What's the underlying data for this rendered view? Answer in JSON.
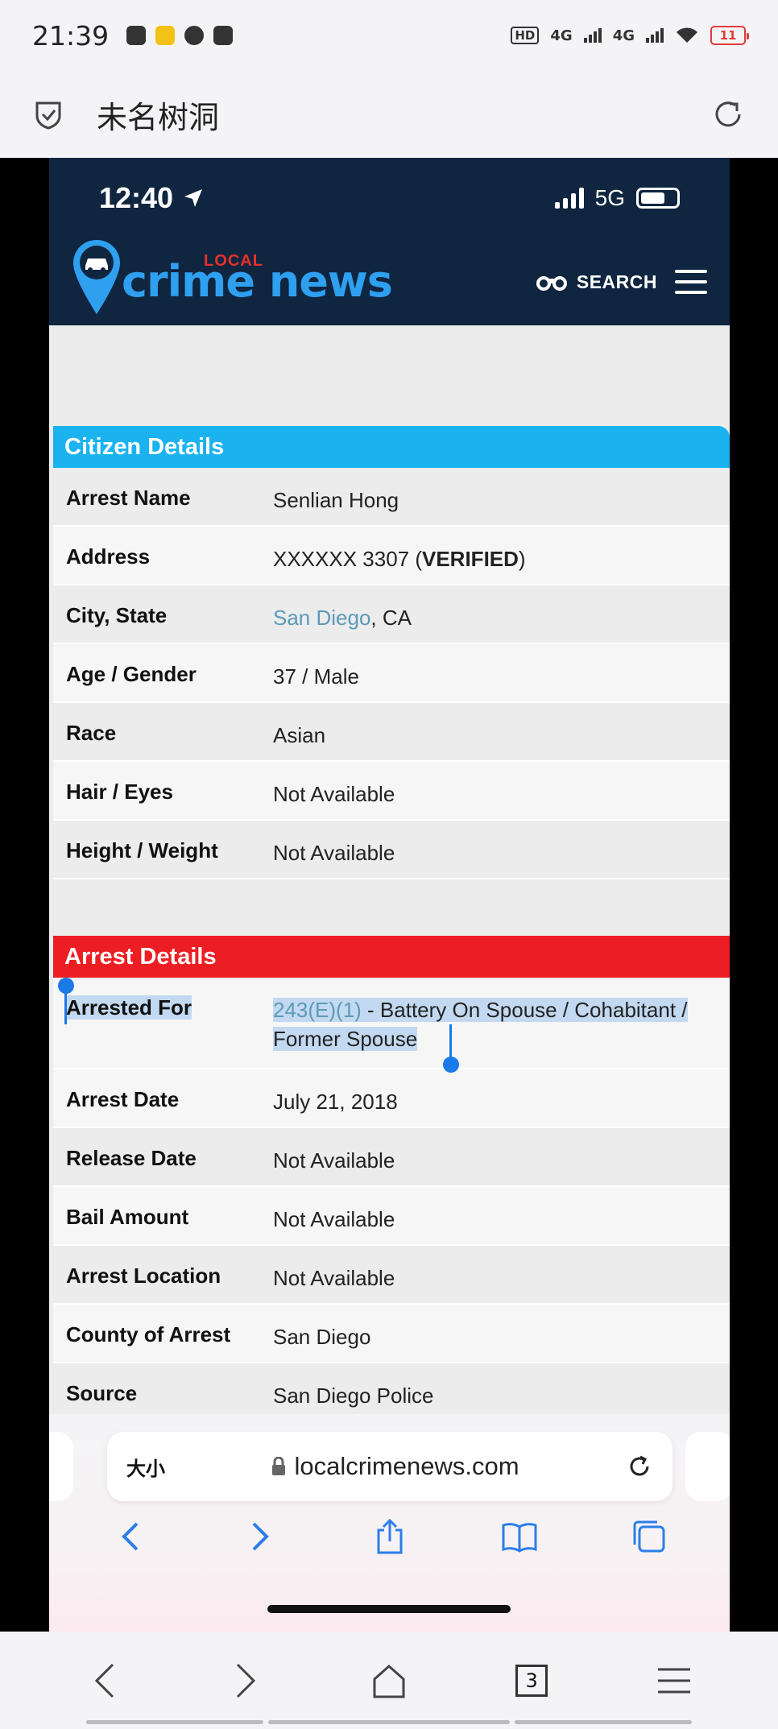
{
  "android_status": {
    "time": "21:39",
    "hd": "HD",
    "net1": "4G",
    "net2": "4G",
    "battery": "11"
  },
  "app_header": {
    "title": "未名树洞"
  },
  "phone": {
    "status": {
      "time": "12:40",
      "network": "5G"
    },
    "site": {
      "logo_small": "LOCAL",
      "logo_main": "crime news",
      "search_label": "SEARCH"
    },
    "citizen": {
      "heading": "Citizen Details",
      "rows": [
        {
          "label": "Arrest Name",
          "value": "Senlian Hong"
        },
        {
          "label": "Address",
          "value_pre": "XXXXXX 3307 (",
          "value_bold": "VERIFIED",
          "value_post": ")"
        },
        {
          "label": "City, State",
          "value_link": "San Diego",
          "value_post": ", CA"
        },
        {
          "label": "Age / Gender",
          "value": "37 / Male"
        },
        {
          "label": "Race",
          "value": "Asian"
        },
        {
          "label": "Hair / Eyes",
          "value": "Not Available"
        },
        {
          "label": "Height / Weight",
          "value": "Not Available"
        }
      ]
    },
    "arrest": {
      "heading": "Arrest Details",
      "rows": [
        {
          "label": "Arrested For",
          "value_link": "243(E)(1)",
          "value_post": " - Battery On Spouse / Cohabitant / Former Spouse"
        },
        {
          "label": "Arrest Date",
          "value": "July 21, 2018"
        },
        {
          "label": "Release Date",
          "value": "Not Available"
        },
        {
          "label": "Bail Amount",
          "value": "Not Available"
        },
        {
          "label": "Arrest Location",
          "value": "Not Available"
        },
        {
          "label": "County of Arrest",
          "value": "San Diego"
        },
        {
          "label": "Source",
          "value": "San Diego Police"
        }
      ]
    },
    "safari": {
      "text_size": "大小",
      "url": "localcrimenews.com"
    }
  },
  "android_nav": {
    "tab_count": "3"
  }
}
